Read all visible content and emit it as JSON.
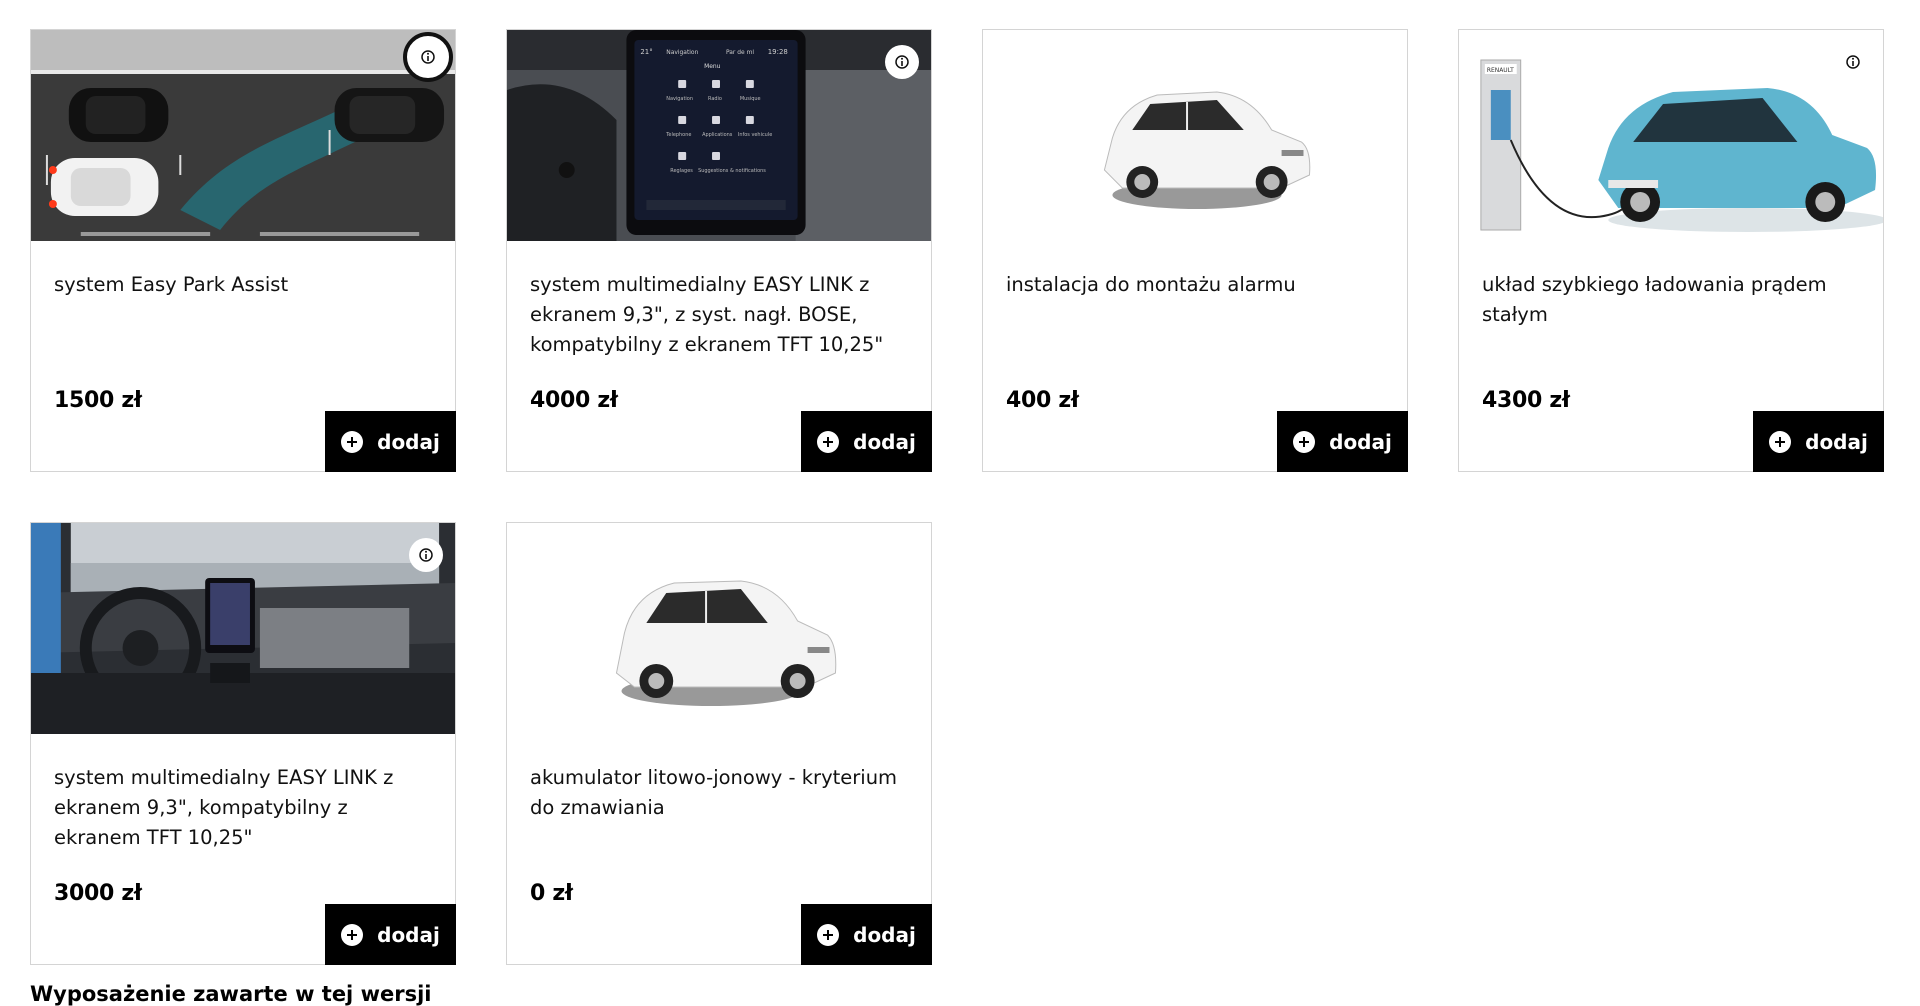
{
  "currency": "zł",
  "add_label": "dodaj",
  "cards": [
    {
      "title": "system Easy Park Assist",
      "price": "1500 zł",
      "image": "parking-illustration"
    },
    {
      "title": "system multimedialny EASY LINK z ekranem 9,3\", z syst. nagł. BOSE, kompatybilny z ekranem TFT 10,25\"",
      "price": "4000 zł",
      "image": "multimedia-screen-photo"
    },
    {
      "title": "instalacja do montażu alarmu",
      "price": "400 zł",
      "image": "white-car-photo"
    },
    {
      "title": "układ szybkiego ładowania prądem stałym",
      "price": "4300 zł",
      "image": "charging-car-photo",
      "station_brand": "RENAULT"
    },
    {
      "title": "system multimedialny EASY LINK z ekranem 9,3\", kompatybilny z ekranem TFT 10,25\"",
      "price": "3000 zł",
      "image": "interior-dashboard-photo"
    },
    {
      "title": "akumulator litowo-jonowy - kryterium do zmawiania",
      "price": "0 zł",
      "image": "white-car-photo"
    }
  ],
  "screen_labels": {
    "time": "19:28",
    "temp": "21°",
    "nav": "Navigation",
    "phone": "Par de ml",
    "menu": "Menu",
    "apps": [
      "Navigation",
      "Radio",
      "Musique",
      "Telephone",
      "Applications",
      "Infos vehicule",
      "Reglages",
      "Suggestions & notifications"
    ]
  },
  "footer_heading": "Wyposażenie zawarte w tej wersji"
}
